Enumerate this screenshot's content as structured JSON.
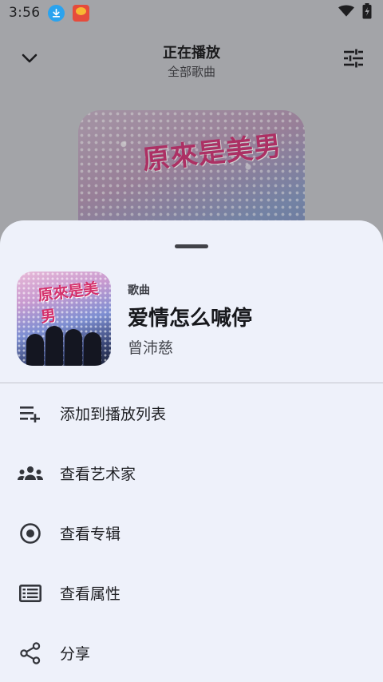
{
  "status_bar": {
    "time": "3:56",
    "icons": [
      "download-icon",
      "app-notification-icon",
      "wifi-icon",
      "battery-charging-icon"
    ]
  },
  "now_playing": {
    "title": "正在播放",
    "subtitle": "全部歌曲",
    "icons": {
      "back": "chevron-down-icon",
      "equalizer": "tune-icon"
    }
  },
  "sheet": {
    "song": {
      "type_label": "歌曲",
      "name": "爱情怎么喊停",
      "artist": "曾沛慈"
    },
    "menu": [
      {
        "label": "添加到播放列表",
        "icon": "playlist-add-icon"
      },
      {
        "label": "查看艺术家",
        "icon": "people-icon"
      },
      {
        "label": "查看专辑",
        "icon": "album-icon"
      },
      {
        "label": "查看属性",
        "icon": "list-details-icon"
      },
      {
        "label": "分享",
        "icon": "share-icon"
      }
    ]
  },
  "colors": {
    "scrim_background": "#a3a4a8",
    "sheet_background": "#eef1fa",
    "text_primary": "#1c1c1f",
    "divider": "#c3c5cd"
  }
}
